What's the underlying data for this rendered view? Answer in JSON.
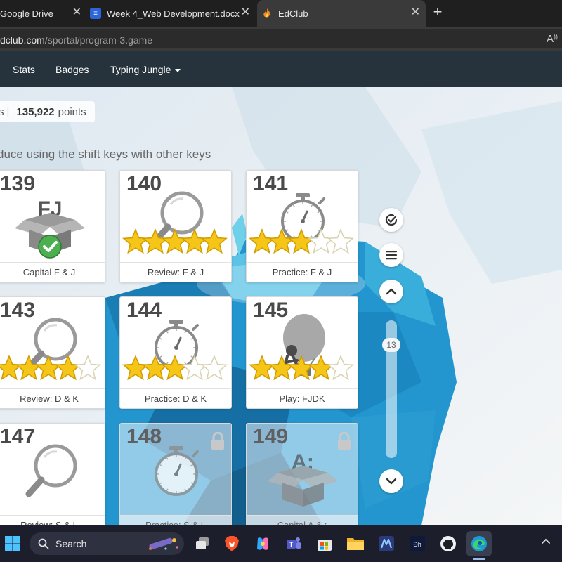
{
  "browser": {
    "tabs": [
      {
        "title": "Google Drive"
      },
      {
        "title": "Week 4_Web Development.docx"
      },
      {
        "title": "EdClub"
      }
    ],
    "url_host": "dclub.com",
    "url_path": "/sportal/program-3.game"
  },
  "nav": {
    "stats": "Stats",
    "badges": "Badges",
    "typing_jungle": "Typing Jungle"
  },
  "points": {
    "left_fragment": "s",
    "value": "135,922",
    "unit": "points"
  },
  "lesson_description": "duce using the shift keys with other keys",
  "lessons": [
    {
      "number": "139",
      "caption": "Capital F & J",
      "kind": "box-complete",
      "box_letters": "FJ",
      "stars": 0,
      "locked": false
    },
    {
      "number": "140",
      "caption": "Review: F & J",
      "kind": "magnifier",
      "stars": 5,
      "locked": false
    },
    {
      "number": "141",
      "caption": "Practice: F & J",
      "kind": "stopwatch",
      "stars": 3,
      "locked": false
    },
    {
      "number": "143",
      "caption": "Review: D & K",
      "kind": "magnifier",
      "stars": 4,
      "locked": false
    },
    {
      "number": "144",
      "caption": "Practice: D & K",
      "kind": "stopwatch",
      "stars": 3,
      "locked": false
    },
    {
      "number": "145",
      "caption": "Play: FJDK",
      "kind": "balloon",
      "stars": 4,
      "locked": false
    },
    {
      "number": "147",
      "caption": "Review: S & L",
      "kind": "magnifier",
      "stars": 0,
      "locked": false
    },
    {
      "number": "148",
      "caption": "Practice: S & L",
      "kind": "stopwatch",
      "stars": 0,
      "locked": true
    },
    {
      "number": "149",
      "caption": "Capital A & ;",
      "kind": "box",
      "box_letters": "A:",
      "stars": 0,
      "locked": true
    }
  ],
  "scroll": {
    "level": "13"
  },
  "taskbar": {
    "search_label": "Search"
  },
  "colors": {
    "nav_bg": "#26333d",
    "star_gold": "#f5c518",
    "check_green": "#4caf50",
    "water_blue": "#1e88c9"
  },
  "icons": [
    "windows-start-icon",
    "search-icon",
    "task-view-icon",
    "brave-icon",
    "copilot-icon",
    "teams-icon",
    "store-icon",
    "file-explorer-icon",
    "mathway-icon",
    "dh-icon",
    "github-icon",
    "edge-icon",
    "tray-chevron-icon"
  ]
}
